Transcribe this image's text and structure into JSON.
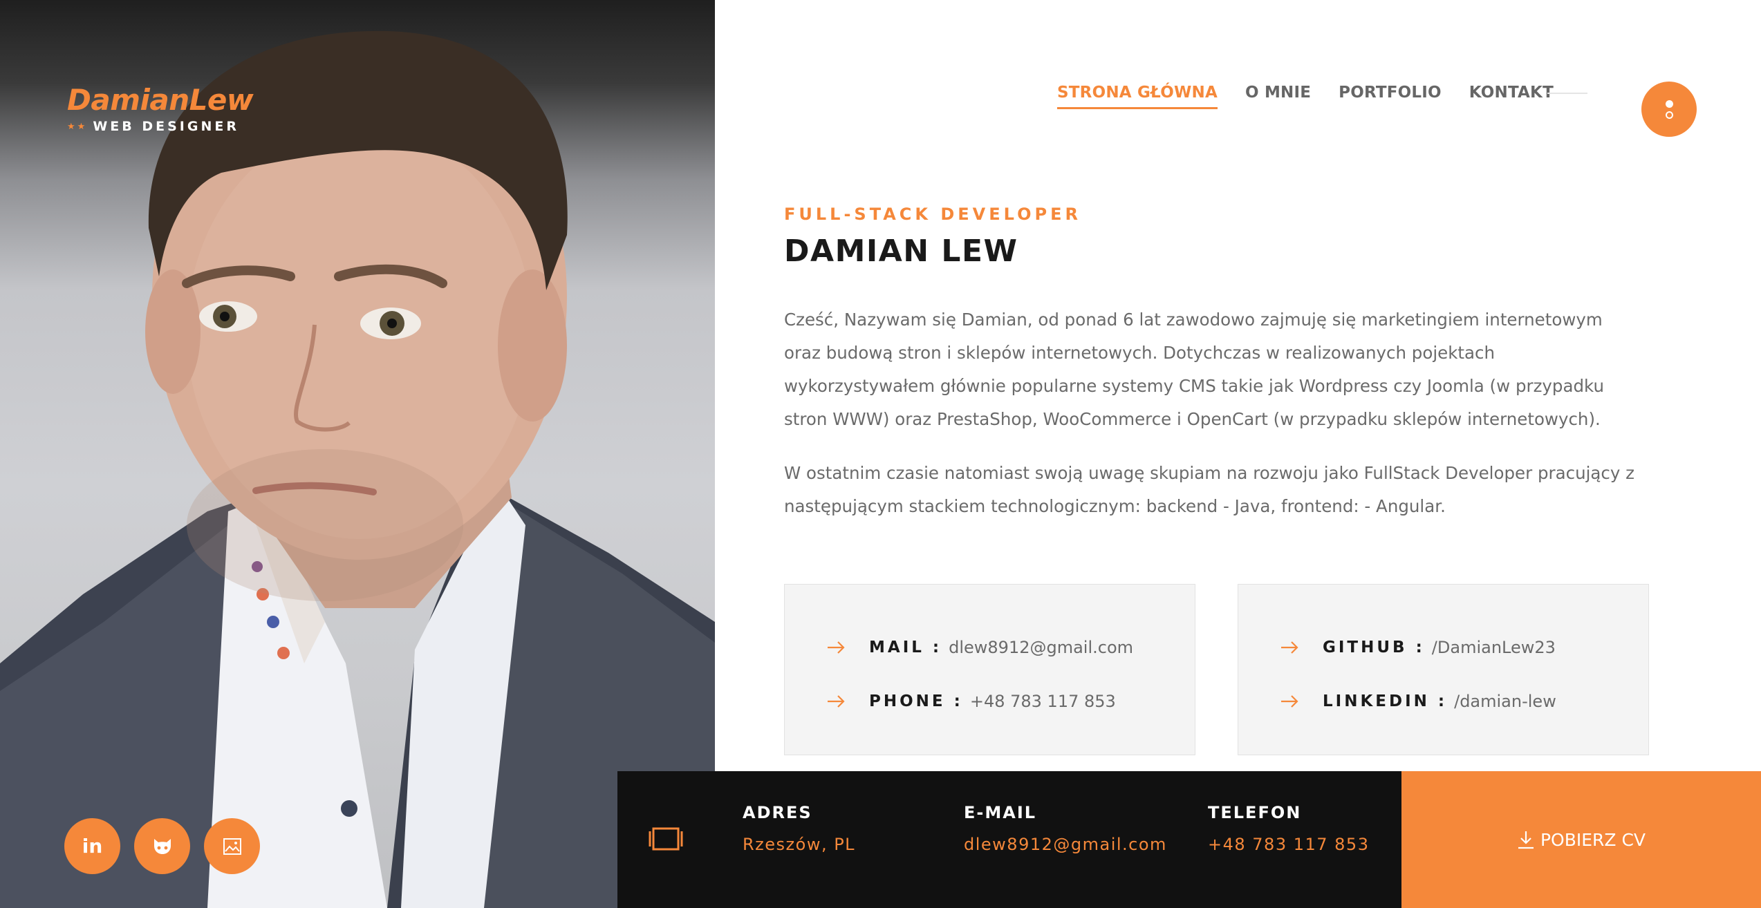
{
  "brand": {
    "name": "DamianLew",
    "stars": "★★",
    "role": "WEB DESIGNER"
  },
  "nav": {
    "items": [
      {
        "label": "STRONA GŁÓWNA",
        "active": true
      },
      {
        "label": "O MNIE",
        "active": false
      },
      {
        "label": "PORTFOLIO",
        "active": false
      },
      {
        "label": "KONTAKT",
        "active": false
      }
    ]
  },
  "intro": {
    "role": "FULL-STACK DEVELOPER",
    "name": "DAMIAN LEW",
    "bio": [
      "Cześć, Nazywam się Damian, od ponad 6 lat zawodowo zajmuję się marketingiem internetowym oraz budową stron i sklepów internetowych. Dotychczas w realizowanych pojektach wykorzystywałem głównie popularne systemy CMS takie jak Wordpress czy Joomla (w przypadku stron WWW) oraz PrestaShop, WooCommerce i OpenCart (w przypadku sklepów internetowych).",
      "W ostatnim czasie natomiast swoją uwagę skupiam na rozwoju jako FullStack Developer pracujący z następującym stackiem technologicznym: backend - Java, frontend: - Angular."
    ]
  },
  "contact_cards": [
    {
      "rows": [
        {
          "label": "MAIL :",
          "value": "dlew8912@gmail.com"
        },
        {
          "label": "PHONE :",
          "value": "+48 783 117 853"
        }
      ]
    },
    {
      "rows": [
        {
          "label": "GITHUB :",
          "value": "/DamianLew23"
        },
        {
          "label": "LINKEDIN :",
          "value": "/damian-lew"
        }
      ]
    }
  ],
  "footer": {
    "address": {
      "label": "ADRES",
      "value": "Rzeszów, PL"
    },
    "email": {
      "label": "E-MAIL",
      "value": "dlew8912@gmail.com"
    },
    "phone": {
      "label": "TELEFON",
      "value": "+48 783 117 853"
    },
    "cv_button": "POBIERZ CV"
  },
  "social": [
    {
      "icon": "linkedin-icon",
      "glyph": "in"
    },
    {
      "icon": "github-icon",
      "glyph": ""
    },
    {
      "icon": "image-icon",
      "glyph": ""
    }
  ],
  "colors": {
    "accent": "#f5883a",
    "dark": "#111111",
    "text": "#6a6a6a",
    "heading": "#1a1a1a",
    "card_bg": "#f4f4f4"
  }
}
